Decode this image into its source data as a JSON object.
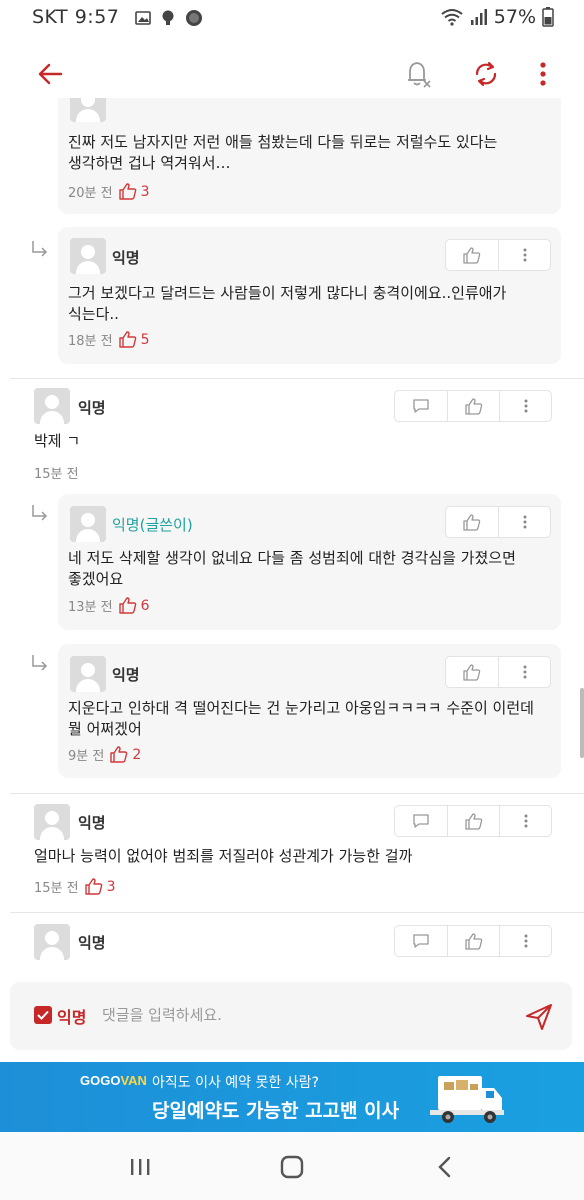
{
  "statusbar": {
    "carrier": "SKT",
    "time": "9:57",
    "battery": "57%"
  },
  "appbar": {
    "back_icon": "back-arrow-icon",
    "notify_icon": "bell-off-icon",
    "refresh_icon": "refresh-icon",
    "more_icon": "more-vertical-icon"
  },
  "colors": {
    "accent": "#c62828",
    "op": "#1fa3a0",
    "ad": "#1d8fd8"
  },
  "comments": {
    "r0": {
      "text1": "진짜 저도 남자지만 저런 애들 첨봤는데 다들 뒤로는 저럴수도 있다는",
      "text2": "생각하면 겁나 역겨워서…",
      "time": "20분 전",
      "likes": "3"
    },
    "r1": {
      "author": "익명",
      "text1": "그거 보겠다고 달려드는 사람들이 저렇게 많다니 충격이에요..인류애가",
      "text2": "식는다..",
      "time": "18분 전",
      "likes": "5"
    },
    "c1": {
      "author": "익명",
      "text1": "박제 ㄱ",
      "time": "15분 전"
    },
    "r2": {
      "author": "익명(글쓴이)",
      "text1": "네 저도 삭제할 생각이 없네요 다들 좀 성범죄에 대한 경각심을 가졌으면",
      "text2": "좋겠어요",
      "time": "13분 전",
      "likes": "6"
    },
    "r3": {
      "author": "익명",
      "text1": "지운다고 인하대 격 떨어진다는 건 눈가리고 아웅임ㅋㅋㅋㅋ 수준이 이런데",
      "text2": "뭘 어쩌겠어",
      "time": "9분 전",
      "likes": "2"
    },
    "c2": {
      "author": "익명",
      "text1": "얼마나 능력이 없어야 범죄를 저질러야 성관계가 가능한 걸까",
      "time": "15분 전",
      "likes": "3"
    },
    "c3": {
      "author": "익명"
    }
  },
  "input": {
    "anon_label": "익명",
    "placeholder": "댓글을 입력하세요."
  },
  "ad": {
    "brand_a": "GOGO",
    "brand_b": "VAN",
    "line1": "아직도 이사 예약 못한 사람?",
    "line2": "당일예약도 가능한 고고밴 이사"
  }
}
